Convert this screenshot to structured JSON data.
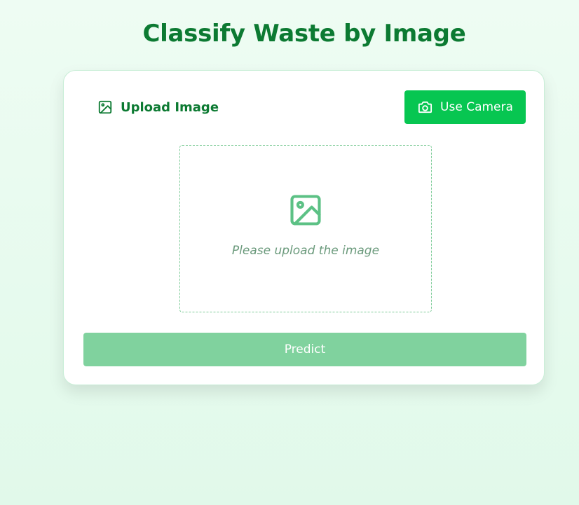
{
  "page": {
    "title": "Classify Waste by Image"
  },
  "tabs": {
    "upload": {
      "label": "Upload Image",
      "icon": "image-icon"
    },
    "camera": {
      "label": "Use Camera",
      "icon": "camera-icon"
    }
  },
  "dropzone": {
    "icon": "image-placeholder-icon",
    "placeholder": "Please upload the image"
  },
  "actions": {
    "predict_label": "Predict",
    "predict_state": "disabled"
  },
  "colors": {
    "title": "#0c7a32",
    "accent": "#07c651",
    "accent_disabled": "#80d29e",
    "dropzone_border": "#7ccb97",
    "placeholder_text": "#6b9a7c",
    "background": "#e6faee"
  }
}
